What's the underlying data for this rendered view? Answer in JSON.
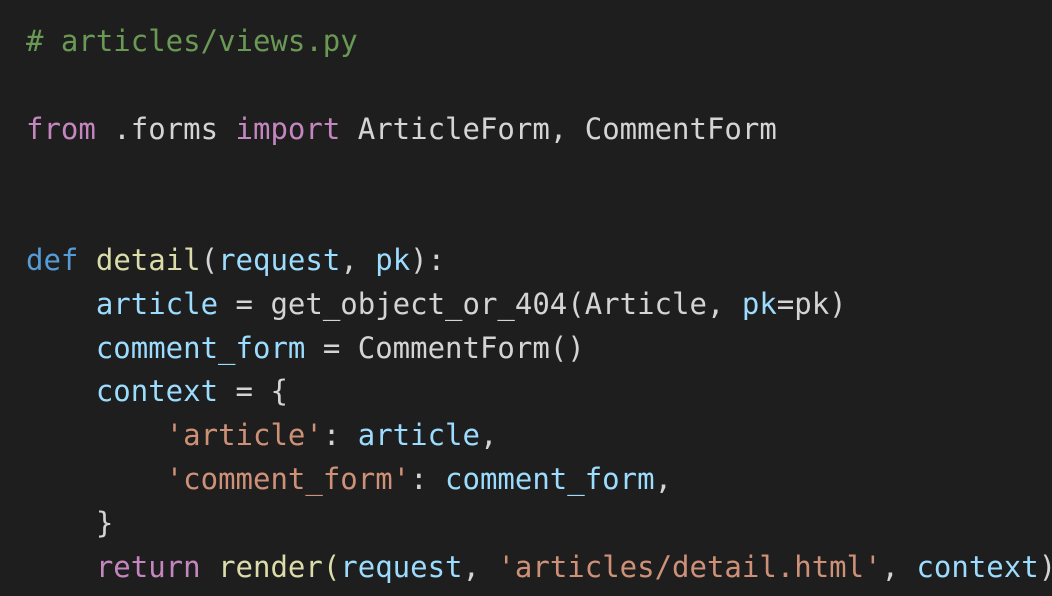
{
  "colors": {
    "background": "#1e1e1e",
    "comment": "#6a9955",
    "control_keyword": "#c586c0",
    "keyword": "#569cd6",
    "function": "#dcdcaa",
    "variable": "#9cdcfe",
    "string": "#ce9178",
    "text": "#d4d4d4"
  },
  "code": {
    "l1": {
      "comment": "# articles/views.py"
    },
    "l3": {
      "from": "from",
      "module": " .forms ",
      "import": "import",
      "names": " ArticleForm, CommentForm"
    },
    "l6": {
      "def": "def",
      "sp": " ",
      "name": "detail",
      "p1": "(",
      "request": "request",
      "comma": ", ",
      "pk": "pk",
      "p2": "):"
    },
    "l7": {
      "indent": "    ",
      "article": "article",
      "eq": " = get_object_or_404(Article, ",
      "pk": "pk",
      "rest": "=pk)"
    },
    "l8": {
      "indent": "    ",
      "comment_form": "comment_form",
      "rest": " = CommentForm()"
    },
    "l9": {
      "indent": "    ",
      "context": "context",
      "rest": " = {"
    },
    "l10": {
      "indent": "        ",
      "key": "'article'",
      "colon": ": ",
      "val": "article",
      "comma": ","
    },
    "l11": {
      "indent": "        ",
      "key": "'comment_form'",
      "colon": ": ",
      "val": "comment_form",
      "comma": ","
    },
    "l12": {
      "indent": "    ",
      "brace": "}"
    },
    "l13": {
      "indent": "    ",
      "return": "return",
      "render": " render(",
      "request": "request",
      "comma1": ", ",
      "template": "'articles/detail.html'",
      "comma2": ", ",
      "context": "context",
      "close": ")"
    }
  }
}
